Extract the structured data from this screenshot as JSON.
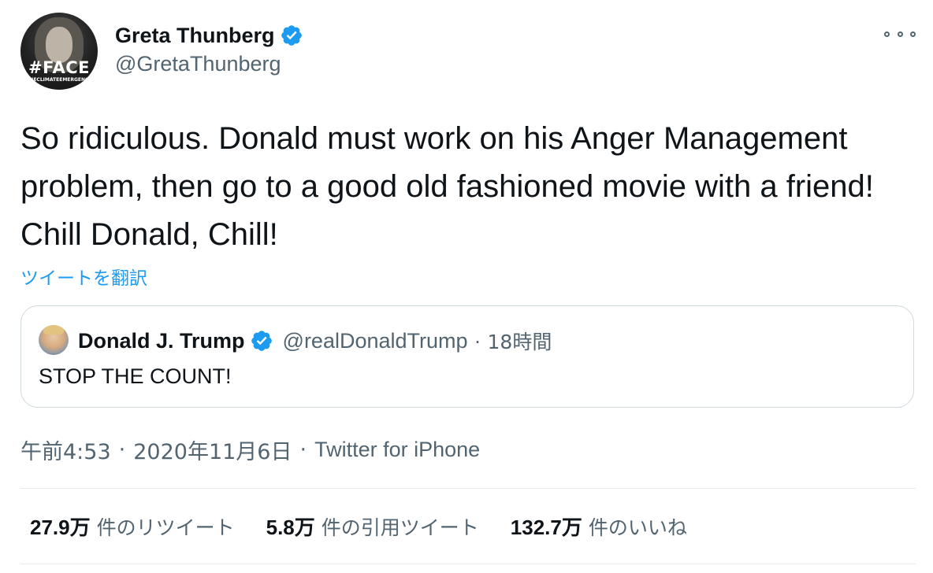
{
  "author": {
    "display_name": "Greta Thunberg",
    "handle": "@GretaThunberg",
    "avatar_text": "#FACE",
    "avatar_subtext": "THECLIMATEEMERGENCY",
    "verified_icon": "verified-badge-icon"
  },
  "tweet": {
    "text": "So ridiculous. Donald must work on his Anger Management problem, then go to a good old fashioned movie with a friend! Chill Donald, Chill!",
    "translate_label": "ツイートを翻訳"
  },
  "quoted_tweet": {
    "display_name": "Donald J. Trump",
    "handle": "@realDonaldTrump",
    "separator": "·",
    "time": "18時間",
    "text": "STOP THE COUNT!"
  },
  "meta": {
    "time": "午前4:53",
    "separator": "·",
    "date": "2020年11月6日",
    "source": "Twitter for iPhone"
  },
  "stats": [
    {
      "value": "27.9万",
      "label": "件のリツイート"
    },
    {
      "value": "5.8万",
      "label": "件の引用ツイート"
    },
    {
      "value": "132.7万",
      "label": "件のいいね"
    }
  ],
  "colors": {
    "verified": "#1d9bf0",
    "link": "#1d9bf0",
    "secondary_text": "#536471",
    "border": "#cfd9de"
  }
}
